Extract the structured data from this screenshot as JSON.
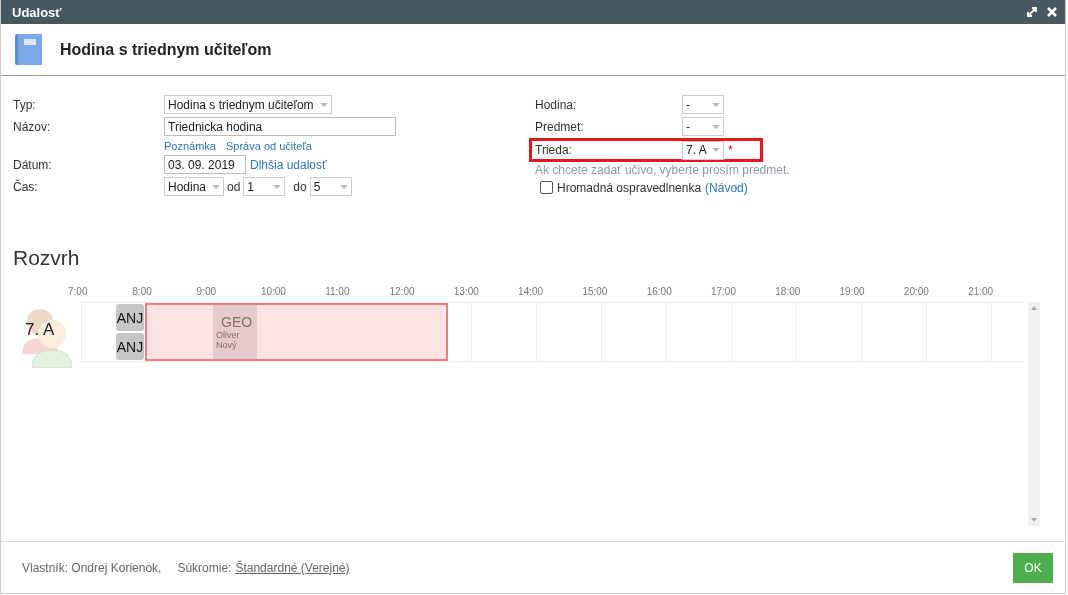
{
  "window": {
    "title": "Udalosť"
  },
  "header": {
    "title": "Hodina s triednym učiteľom"
  },
  "form_left": {
    "typ": {
      "label": "Typ:",
      "value": "Hodina s triednym učiteľom"
    },
    "nazov": {
      "label": "Názov:",
      "value": "Triednicka hodina"
    },
    "links": [
      "Poznámka",
      "Správa od učiteľa"
    ],
    "datum": {
      "label": "Dátum:",
      "value": "03. 09. 2019",
      "link": "Dlhšia udalosť"
    },
    "cas": {
      "label": "Čas:",
      "mode": "Hodina",
      "from_label": "od",
      "from": "1",
      "to_label": "do",
      "to": "5"
    }
  },
  "form_right": {
    "hodina": {
      "label": "Hodina:",
      "value": "-"
    },
    "predmet": {
      "label": "Predmet:",
      "value": "-"
    },
    "trieda": {
      "label": "Trieda:",
      "value": "7. A",
      "required": "*",
      "highlighted": true
    },
    "hint": "Ak chcete zadať učivo, vyberte prosím predmet.",
    "bulk": {
      "label": "Hromadná ospravedlnenka",
      "checked": false,
      "link": "(Návod)"
    }
  },
  "schedule": {
    "title": "Rozvrh",
    "hours": [
      "7:00",
      "8:00",
      "9:00",
      "10:00",
      "11:00",
      "12:00",
      "13:00",
      "14:00",
      "15:00",
      "16:00",
      "17:00",
      "18:00",
      "19:00",
      "20:00",
      "21:00"
    ],
    "row_label": "7. A",
    "events": [
      {
        "kind": "small",
        "subject": "ANJ"
      },
      {
        "kind": "small",
        "subject": "ANJ"
      },
      {
        "kind": "lesson",
        "subject": "GEO",
        "teacher": "Oliver Nový"
      }
    ]
  },
  "footer": {
    "owner": "Vlastník: Ondrej Korienok,",
    "privacy_label": "Súkromie:",
    "privacy": "Štandardné (Verejné)"
  },
  "buttons": [
    "OK"
  ]
}
